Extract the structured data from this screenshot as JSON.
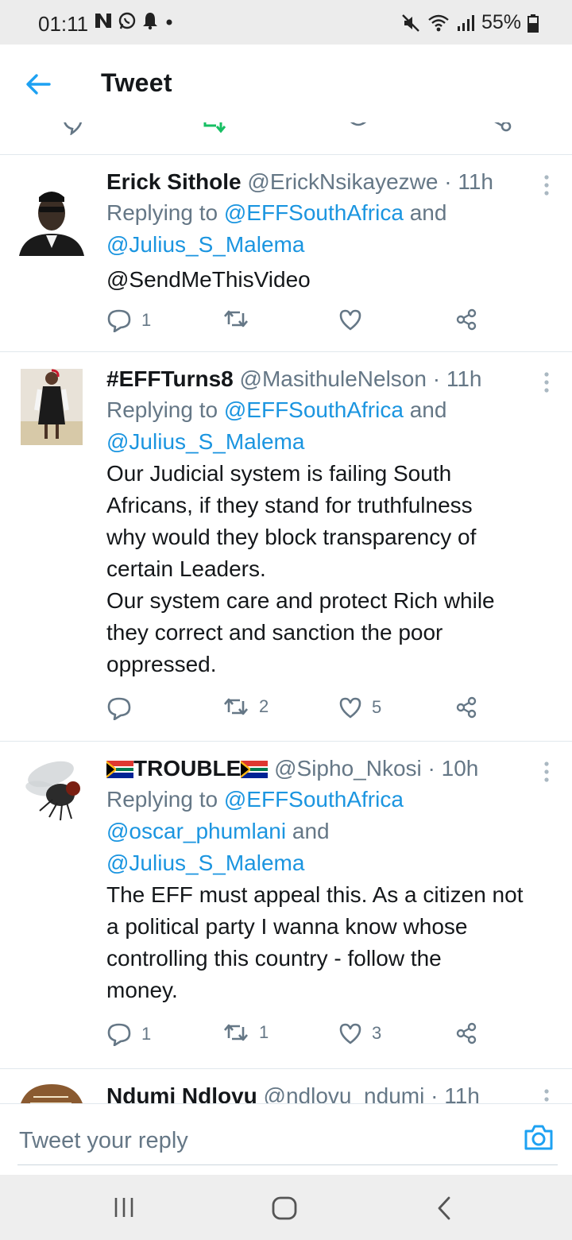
{
  "status_bar": {
    "time": "01:11",
    "battery": "55%",
    "icons": [
      "n-app-icon",
      "whatsapp-icon",
      "notification-bell-icon",
      "dot-icon",
      "mute-icon",
      "wifi-icon",
      "signal-icon",
      "battery-icon"
    ]
  },
  "header": {
    "title": "Tweet",
    "back_icon": "back-arrow-icon"
  },
  "tweets": [
    {
      "name": "Erick  Sithole",
      "handle": "@ErickNsikayezwe",
      "time": "11h",
      "replying_prefix": "Replying to ",
      "replying_lines": [
        [
          {
            "text": "@EFFSouthAfrica",
            "link": true
          },
          {
            "text": " and",
            "link": false
          }
        ],
        [
          {
            "text": "@Julius_S_Malema",
            "link": true
          }
        ]
      ],
      "text_lines": [],
      "link_lines": [
        "@SendMeThisVideo"
      ],
      "replies": "1",
      "retweets": "",
      "likes": ""
    },
    {
      "name": "#EFFTurns8",
      "handle": "@MasithuleNelson",
      "time": "11h",
      "replying_prefix": "Replying to ",
      "replying_lines": [
        [
          {
            "text": "@EFFSouthAfrica",
            "link": true
          },
          {
            "text": " and",
            "link": false
          }
        ],
        [
          {
            "text": "@Julius_S_Malema",
            "link": true
          }
        ]
      ],
      "text_lines": [
        "Our Judicial system is failing South",
        "Africans, if they stand for truthfulness",
        "why would they block transparency of",
        "certain Leaders.",
        "Our system care and protect Rich while",
        "they correct and sanction the poor",
        "oppressed."
      ],
      "link_lines": [],
      "replies": "",
      "retweets": "2",
      "likes": "5"
    },
    {
      "name": "TROUBLE",
      "name_flags": "south-africa-flag-icon",
      "handle": "@Sipho_Nkosi",
      "time": "10h",
      "replying_prefix": "Replying to ",
      "replying_lines": [
        [
          {
            "text": "@EFFSouthAfrica",
            "link": true
          }
        ],
        [
          {
            "text": "@oscar_phumlani",
            "link": true
          },
          {
            "text": " and",
            "link": false
          }
        ],
        [
          {
            "text": "@Julius_S_Malema",
            "link": true
          }
        ]
      ],
      "text_lines": [
        "The EFF must appeal this. As a citizen not",
        "a political party I wanna know whose",
        "controlling this country - follow the",
        "money."
      ],
      "link_lines": [],
      "replies": "1",
      "retweets": "1",
      "likes": "3"
    },
    {
      "name": "Ndumi Ndlovu",
      "handle": "@ndlovu_ndumi",
      "time": "11h"
    }
  ],
  "reply_bar": {
    "placeholder": "Tweet your reply",
    "camera_icon": "camera-icon"
  },
  "nav_bar": {
    "icons": [
      "recents-icon",
      "home-icon",
      "back-icon"
    ]
  },
  "colors": {
    "link": "#1b95e0",
    "secondary": "#657786",
    "text": "#14171a",
    "divider": "#e1e8ed"
  }
}
